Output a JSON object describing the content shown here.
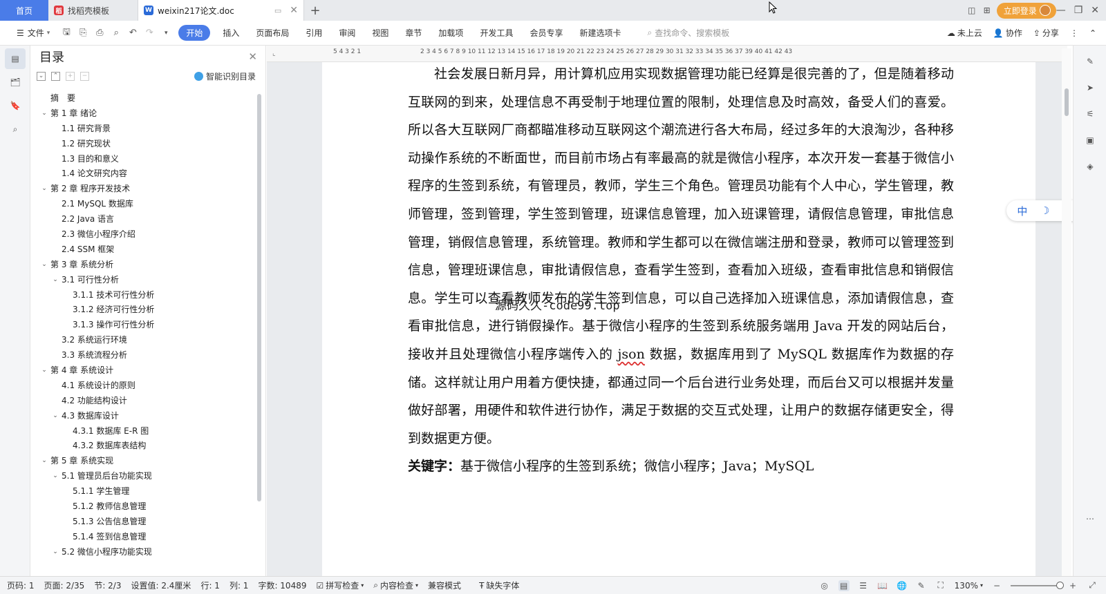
{
  "tabs": {
    "home": "首页",
    "template_tab": "找稻壳模板",
    "doc_tab": "weixin217论文.doc",
    "login": "立即登录"
  },
  "ribbon": {
    "file": "文件",
    "start": "开始",
    "menu": [
      "插入",
      "页面布局",
      "引用",
      "审阅",
      "视图",
      "章节",
      "加载项",
      "开发工具",
      "会员专享",
      "新建选项卡"
    ],
    "search_placeholder": "查找命令、搜索模板",
    "cloud": "未上云",
    "collab": "协作",
    "share": "分享"
  },
  "toc": {
    "title": "目录",
    "smart": "智能识别目录",
    "items": [
      {
        "text": "摘　要",
        "level": 0,
        "arrow": false
      },
      {
        "text": "第 1 章  绪论",
        "level": 0,
        "arrow": true
      },
      {
        "text": "1.1  研究背景",
        "level": 1,
        "arrow": false
      },
      {
        "text": "1.2  研究现状",
        "level": 1,
        "arrow": false
      },
      {
        "text": "1.3  目的和意义",
        "level": 1,
        "arrow": false
      },
      {
        "text": "1.4  论文研究内容",
        "level": 1,
        "arrow": false
      },
      {
        "text": "第 2 章  程序开发技术",
        "level": 0,
        "arrow": true
      },
      {
        "text": "2.1 MySQL 数据库",
        "level": 1,
        "arrow": false
      },
      {
        "text": "2.2 Java 语言",
        "level": 1,
        "arrow": false
      },
      {
        "text": "2.3  微信小程序介绍",
        "level": 1,
        "arrow": false
      },
      {
        "text": "2.4 SSM 框架",
        "level": 1,
        "arrow": false
      },
      {
        "text": "第 3 章  系统分析",
        "level": 0,
        "arrow": true
      },
      {
        "text": "3.1 可行性分析",
        "level": 1,
        "arrow": true
      },
      {
        "text": "3.1.1 技术可行性分析",
        "level": 2,
        "arrow": false
      },
      {
        "text": "3.1.2 经济可行性分析",
        "level": 2,
        "arrow": false
      },
      {
        "text": "3.1.3 操作可行性分析",
        "level": 2,
        "arrow": false
      },
      {
        "text": "3.2 系统运行环境",
        "level": 1,
        "arrow": false
      },
      {
        "text": "3.3 系统流程分析",
        "level": 1,
        "arrow": false
      },
      {
        "text": "第 4 章  系统设计",
        "level": 0,
        "arrow": true
      },
      {
        "text": "4.1  系统设计的原则",
        "level": 1,
        "arrow": false
      },
      {
        "text": "4.2  功能结构设计",
        "level": 1,
        "arrow": false
      },
      {
        "text": "4.3  数据库设计",
        "level": 1,
        "arrow": true
      },
      {
        "text": "4.3.1  数据库 E-R 图",
        "level": 2,
        "arrow": false
      },
      {
        "text": "4.3.2  数据库表结构",
        "level": 2,
        "arrow": false
      },
      {
        "text": "第 5 章  系统实现",
        "level": 0,
        "arrow": true
      },
      {
        "text": "5.1 管理员后台功能实现",
        "level": 1,
        "arrow": true
      },
      {
        "text": "5.1.1  学生管理",
        "level": 2,
        "arrow": false
      },
      {
        "text": "5.1.2  教师信息管理",
        "level": 2,
        "arrow": false
      },
      {
        "text": "5.1.3  公告信息管理",
        "level": 2,
        "arrow": false
      },
      {
        "text": "5.1.4  签到信息管理",
        "level": 2,
        "arrow": false
      },
      {
        "text": "5.2  微信小程序功能实现",
        "level": 1,
        "arrow": true
      }
    ]
  },
  "ruler": {
    "left_numbers": "5  4  3  2  1",
    "right_numbers": "2  3  4  5  6  7  8  9  10  11  12  13  14  15  16  17  18  19  20  21  22  23  24  25  26  27  28  29  30  31  32  33  34  35  36  37  39  40  41  42  43"
  },
  "document": {
    "paragraph_before_json": "社会发展日新月异，用计算机应用实现数据管理功能已经算是很完善的了，但是随着移动互联网的到来，处理信息不再受制于地理位置的限制，处理信息及时高效，备受人们的喜爱。所以各大互联网厂商都瞄准移动互联网这个潮流进行各大布局，经过多年的大浪淘沙，各种移动操作系统的不断面世，而目前市场占有率最高的就是微信小程序，本次开发一套基于微信小程序的生签到系统，有管理员，教师，学生三个角色。管理员功能有个人中心，学生管理，教师管理，签到管理，学生签到管理，班课信息管理，加入班课管理，请假信息管理，审批信息管理，销假信息管理，系统管理。教师和学生都可以在微信端注册和登录，教师可以管理签到信息，管理班课信息，审批请假信息，查看学生签到，查看加入班级，查看审批信息和销假信息。学生可以查看教师发布的学生签到信息，可以自己选择加入班课信息，添加请假信息，查看审批信息，进行销假操作。基于微信小程序的生签到系统服务端用 Java 开发的网站后台，接收并且处理微信小程序端传入的 ",
    "json_word": "json",
    "paragraph_after_json": " 数据，数据库用到了 MySQL 数据库作为数据的存储。这样就让用户用着方便快捷，都通过同一个后台进行业务处理，而后台又可以根据并发量做好部署，用硬件和软件进行协作，满足于数据的交互式处理，让用户的数据存储更安全，得到数据更方便。",
    "keywords_label": "关键字：",
    "keywords": "基于微信小程序的生签到系统；微信小程序；Java；MySQL",
    "watermark": "源码久久-code99.top"
  },
  "ime": {
    "lang": "中",
    "moon": "☽",
    "punct": "°,"
  },
  "status": {
    "page_code": "页码: 1",
    "page": "页面: 2/35",
    "section": "节: 2/3",
    "setting": "设置值: 2.4厘米",
    "row": "行: 1",
    "col": "列: 1",
    "word_count": "字数: 10489",
    "spell": "拼写检查",
    "content_check": "内容检查",
    "compat": "兼容模式",
    "missing_font": "缺失字体",
    "zoom": "130%"
  }
}
